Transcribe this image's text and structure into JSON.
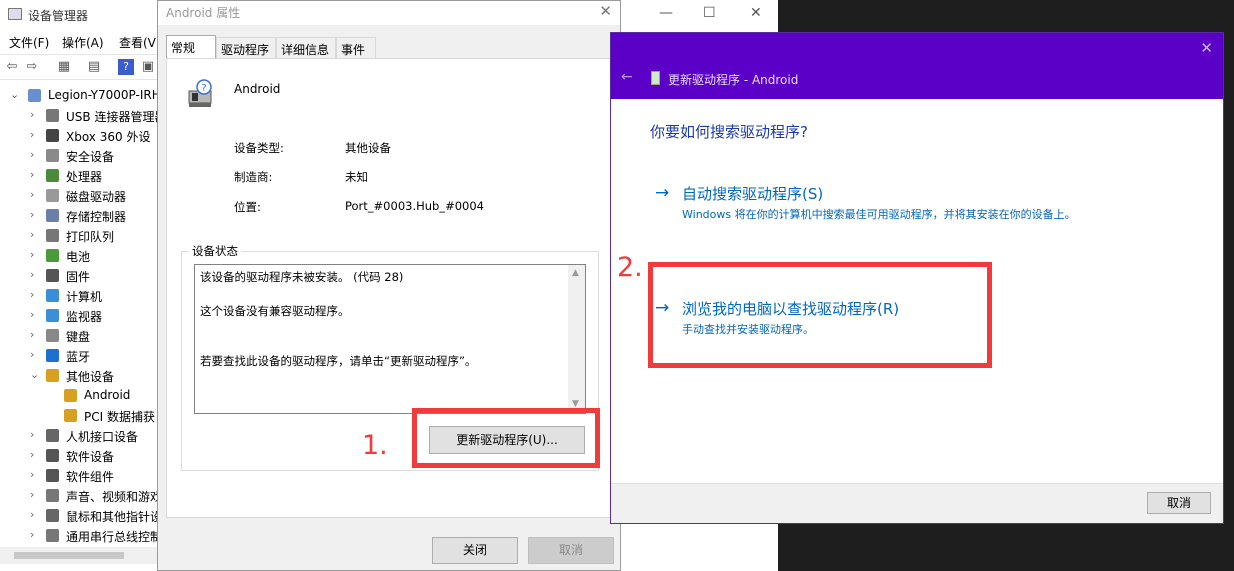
{
  "device_manager": {
    "title": "设备管理器",
    "menus": [
      "文件(F)",
      "操作(A)",
      "查看(V)"
    ],
    "tree": [
      {
        "label": "Legion-Y7000P-IRH",
        "level": 0,
        "expanded": true,
        "icon": "computer-icon"
      },
      {
        "label": "USB 连接器管理器",
        "level": 1,
        "icon": "usb-icon"
      },
      {
        "label": "Xbox 360 外设",
        "level": 1,
        "icon": "gamepad-icon"
      },
      {
        "label": "安全设备",
        "level": 1,
        "icon": "security-icon"
      },
      {
        "label": "处理器",
        "level": 1,
        "icon": "cpu-icon"
      },
      {
        "label": "磁盘驱动器",
        "level": 1,
        "icon": "disk-icon"
      },
      {
        "label": "存储控制器",
        "level": 1,
        "icon": "storage-icon"
      },
      {
        "label": "打印队列",
        "level": 1,
        "icon": "printer-icon"
      },
      {
        "label": "电池",
        "level": 1,
        "icon": "battery-icon"
      },
      {
        "label": "固件",
        "level": 1,
        "icon": "firmware-icon"
      },
      {
        "label": "计算机",
        "level": 1,
        "icon": "monitor-icon"
      },
      {
        "label": "监视器",
        "level": 1,
        "icon": "monitor-icon"
      },
      {
        "label": "键盘",
        "level": 1,
        "icon": "keyboard-icon"
      },
      {
        "label": "蓝牙",
        "level": 1,
        "icon": "bluetooth-icon"
      },
      {
        "label": "其他设备",
        "level": 1,
        "expanded": true,
        "icon": "warning-device-icon"
      },
      {
        "label": "Android",
        "level": 2,
        "icon": "warning-device-icon"
      },
      {
        "label": "PCI 数据捕获",
        "level": 2,
        "icon": "warning-device-icon"
      },
      {
        "label": "人机接口设备",
        "level": 1,
        "icon": "hid-icon"
      },
      {
        "label": "软件设备",
        "level": 1,
        "icon": "software-device-icon"
      },
      {
        "label": "软件组件",
        "level": 1,
        "icon": "component-icon"
      },
      {
        "label": "声音、视频和游戏",
        "level": 1,
        "icon": "speaker-icon"
      },
      {
        "label": "鼠标和其他指针设",
        "level": 1,
        "icon": "mouse-icon"
      },
      {
        "label": "通用串行总线控制",
        "level": 1,
        "icon": "usb-icon"
      }
    ]
  },
  "properties": {
    "title": "Android 属性",
    "tabs": [
      "常规",
      "驱动程序",
      "详细信息",
      "事件"
    ],
    "device_name": "Android",
    "info": [
      {
        "label": "设备类型:",
        "value": "其他设备"
      },
      {
        "label": "制造商:",
        "value": "未知"
      },
      {
        "label": "位置:",
        "value": "Port_#0003.Hub_#0004"
      }
    ],
    "status_legend": "设备状态",
    "status_lines": [
      "该设备的驱动程序未被安装。 (代码 28)",
      "这个设备没有兼容驱动程序。",
      "若要查找此设备的驱动程序，请单击“更新驱动程序”。"
    ],
    "update_button": "更新驱动程序(U)...",
    "close_button": "关闭",
    "cancel_button": "取消"
  },
  "wizard": {
    "title": "更新驱动程序 - Android",
    "question": "你要如何搜索驱动程序?",
    "option1_title": "自动搜索驱动程序(S)",
    "option1_desc": "Windows 将在你的计算机中搜索最佳可用驱动程序，并将其安装在你的设备上。",
    "option2_title": "浏览我的电脑以查找驱动程序(R)",
    "option2_desc": "手动查找并安装驱动程序。",
    "cancel_button": "取消",
    "header_color": "#5b00c7"
  },
  "annotations": {
    "step1": "1.",
    "step2": "2.",
    "color": "#ef3b3b"
  }
}
